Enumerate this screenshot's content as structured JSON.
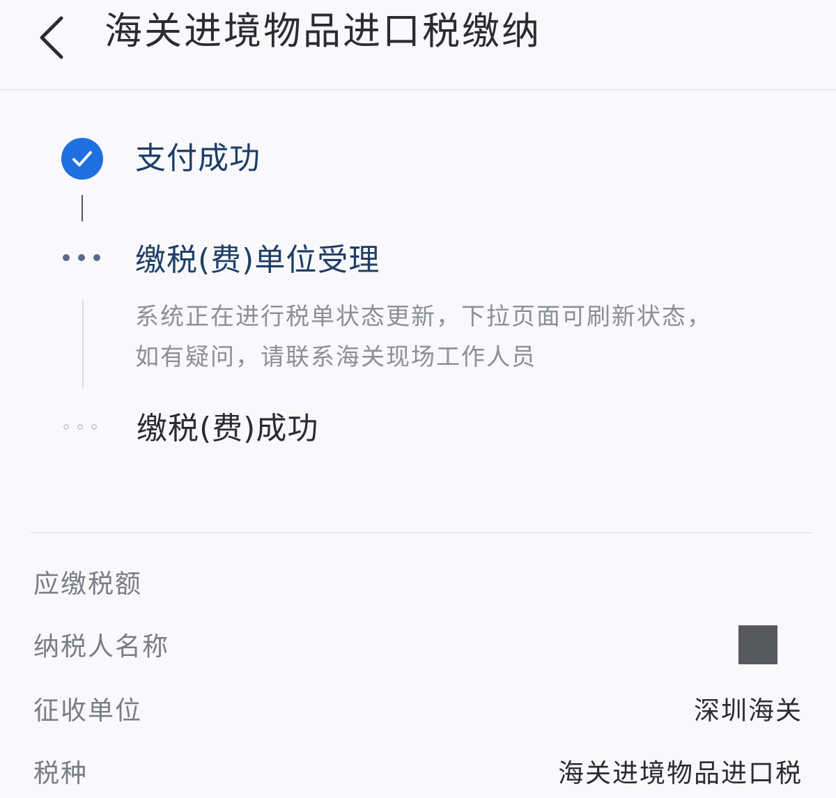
{
  "header": {
    "title": "海关进境物品进口税缴纳",
    "back_icon": "chevron-left-icon"
  },
  "timeline": {
    "steps": [
      {
        "title": "支付成功",
        "state": "done",
        "icon": "check-circle-icon"
      },
      {
        "title": "缴税(费)单位受理",
        "state": "in-progress",
        "icon": "ellipsis-icon",
        "description": "系统正在进行税单状态更新，下拉页面可刷新状态，如有疑问，请联系海关现场工作人员"
      },
      {
        "title": "缴税(费)成功",
        "state": "pending",
        "icon": "ellipsis-icon"
      }
    ]
  },
  "details": {
    "amount": {
      "label": "应缴税额",
      "value": ""
    },
    "payer": {
      "label": "纳税人名称",
      "value": ""
    },
    "unit": {
      "label": "征收单位",
      "value": "深圳海关"
    },
    "type": {
      "label": "税种",
      "value": "海关进境物品进口税"
    }
  },
  "colors": {
    "accent": "#1f6fe0",
    "title_active": "#1e3e66",
    "muted": "#8c8f96",
    "background": "#f9f9fc"
  }
}
